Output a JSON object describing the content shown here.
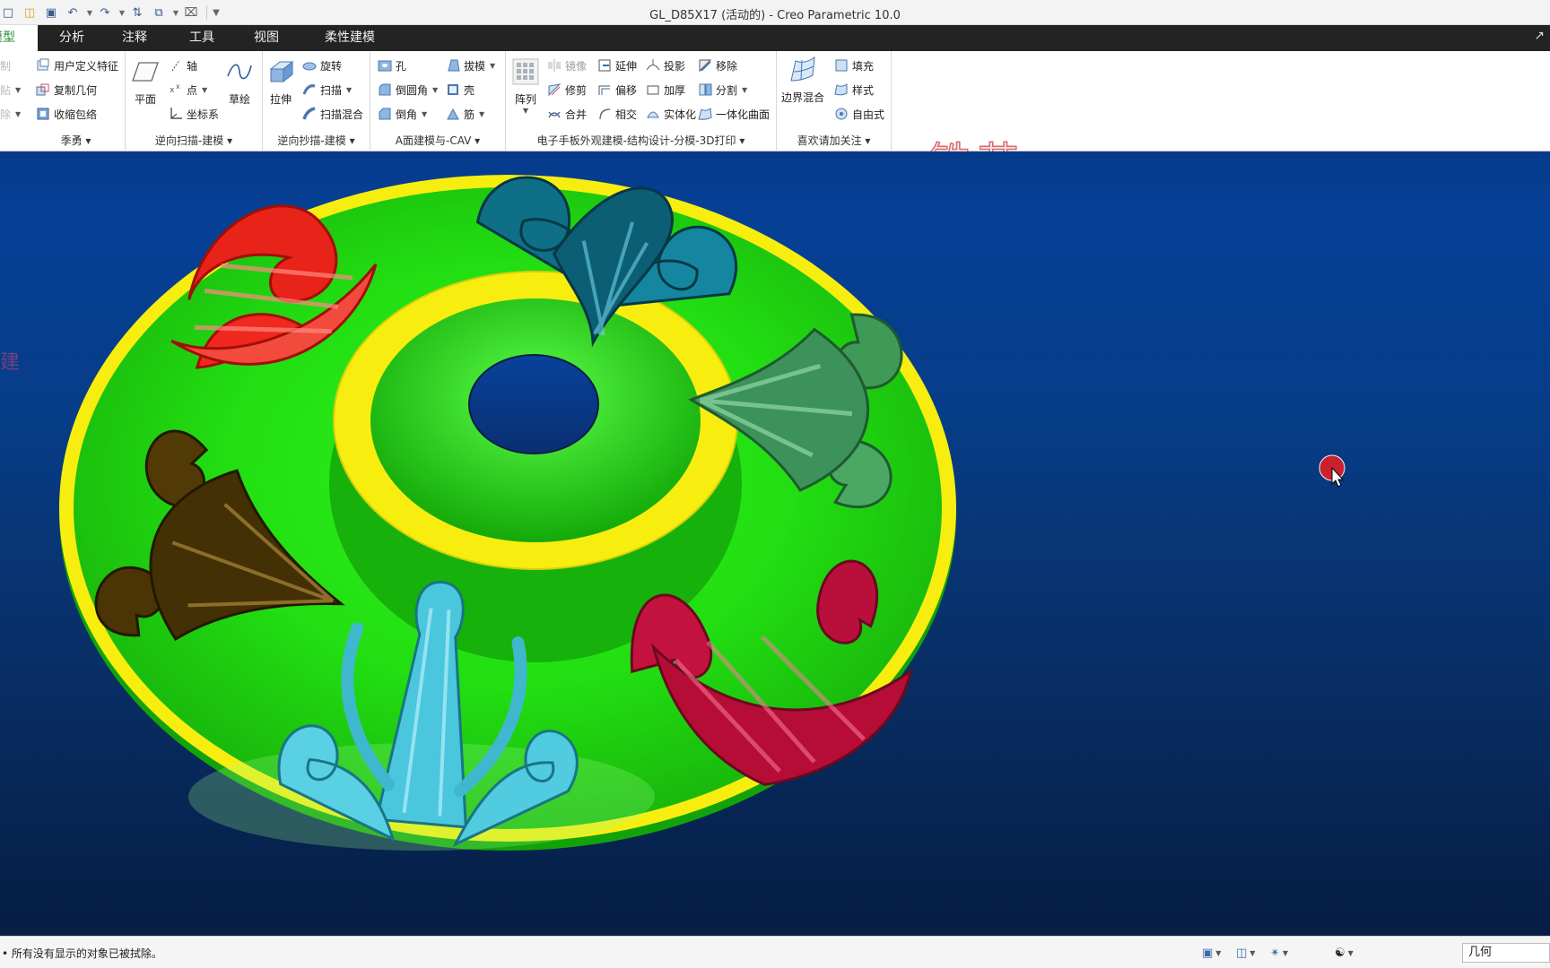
{
  "window": {
    "title": "GL_D85X17 (活动的) - Creo Parametric 10.0"
  },
  "quick_access": {
    "icons": [
      "new-icon",
      "open-icon",
      "save-icon",
      "undo-icon",
      "redo-icon",
      "regenerate-icon",
      "windows-icon",
      "close-window-icon",
      "customize-icon"
    ]
  },
  "tabs": [
    {
      "label": "模型",
      "shown": "模型",
      "active": true
    },
    {
      "label": "分析"
    },
    {
      "label": "注释"
    },
    {
      "label": "工具"
    },
    {
      "label": "视图"
    },
    {
      "label": "柔性建模"
    }
  ],
  "ribbon": {
    "group_operations": {
      "label": "季勇",
      "items": [
        "用户定义特征",
        "复制几何",
        "收缩包络"
      ],
      "clipped": [
        "制",
        "贴",
        "除"
      ]
    },
    "group_datum": {
      "label": "逆向扫描-建模",
      "plane": "平面",
      "axis": "轴",
      "point": "点",
      "csys": "坐标系",
      "sketch": "草绘"
    },
    "group_shapes": {
      "label": "逆向抄描-建模",
      "extrude": "拉伸",
      "revolve": "旋转",
      "sweep": "扫描",
      "swept_blend": "扫描混合"
    },
    "group_engineering": {
      "label": "A面建模与-CAV",
      "hole": "孔",
      "draft": "拔模",
      "round": "倒圆角",
      "shell": "壳",
      "chamfer": "倒角",
      "rib": "筋"
    },
    "group_editing": {
      "label": "电子手板外观建模-结构设计-分模-3D打印",
      "pattern": "阵列",
      "mirror": "镜像",
      "extend": "延伸",
      "project": "投影",
      "remove": "移除",
      "trim": "修剪",
      "offset": "偏移",
      "thicken": "加厚",
      "split": "分割",
      "merge": "合并",
      "intersect": "相交",
      "solidify": "实体化",
      "unify": "一体化曲面"
    },
    "group_surfaces": {
      "label": "喜欢请加关注",
      "boundary_blend": "边界混合",
      "fill": "填充",
      "style": "样式",
      "freestyle": "自由式"
    },
    "watermark": "铁艺",
    "colors": {
      "tab_bar": "#232323",
      "active_tab_text": "#1e8d2c",
      "watermark_stroke": "#d86b6b"
    }
  },
  "viewport": {
    "left_overlay_text": "建",
    "model": {
      "disc_color": "#21e010",
      "ring_color": "#f7ee10",
      "ornaments": [
        {
          "name": "red",
          "color": "#f0281e"
        },
        {
          "name": "teal",
          "color": "#0f6f86"
        },
        {
          "name": "green",
          "color": "#3f9a57"
        },
        {
          "name": "crimson",
          "color": "#c3123e"
        },
        {
          "name": "cyan",
          "color": "#4ac7dc"
        },
        {
          "name": "brown",
          "color": "#4b3504"
        }
      ]
    },
    "background_top": "#053a8a",
    "background_bottom": "#061d44",
    "cursor_marker_color": "#d4202a"
  },
  "statusbar": {
    "message": "• 所有没有显示的对象已被拭除。",
    "selection_filter": "几何"
  }
}
